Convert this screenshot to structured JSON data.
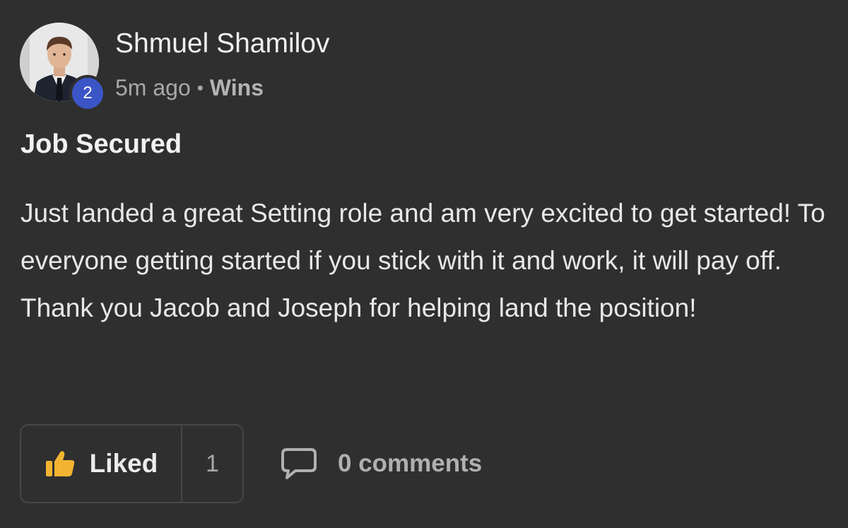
{
  "author": {
    "name": "Shmuel Shamilov",
    "level": "2"
  },
  "meta": {
    "time": "5m ago",
    "separator": "•",
    "category": "Wins"
  },
  "post": {
    "title": "Job Secured",
    "body": "Just landed a great Setting role and am very excited to get started! To everyone getting started if you stick with it and work, it will pay off. Thank you Jacob and Joseph for helping land the position!"
  },
  "actions": {
    "like_label": "Liked",
    "like_count": "1",
    "comments_label": "0 comments"
  },
  "colors": {
    "background": "#2f2f2f",
    "level_badge": "#3b55c7",
    "liked_thumb": "#f2b431"
  },
  "icons": {
    "like": "thumbs-up-icon",
    "comments": "comment-bubble-icon"
  }
}
